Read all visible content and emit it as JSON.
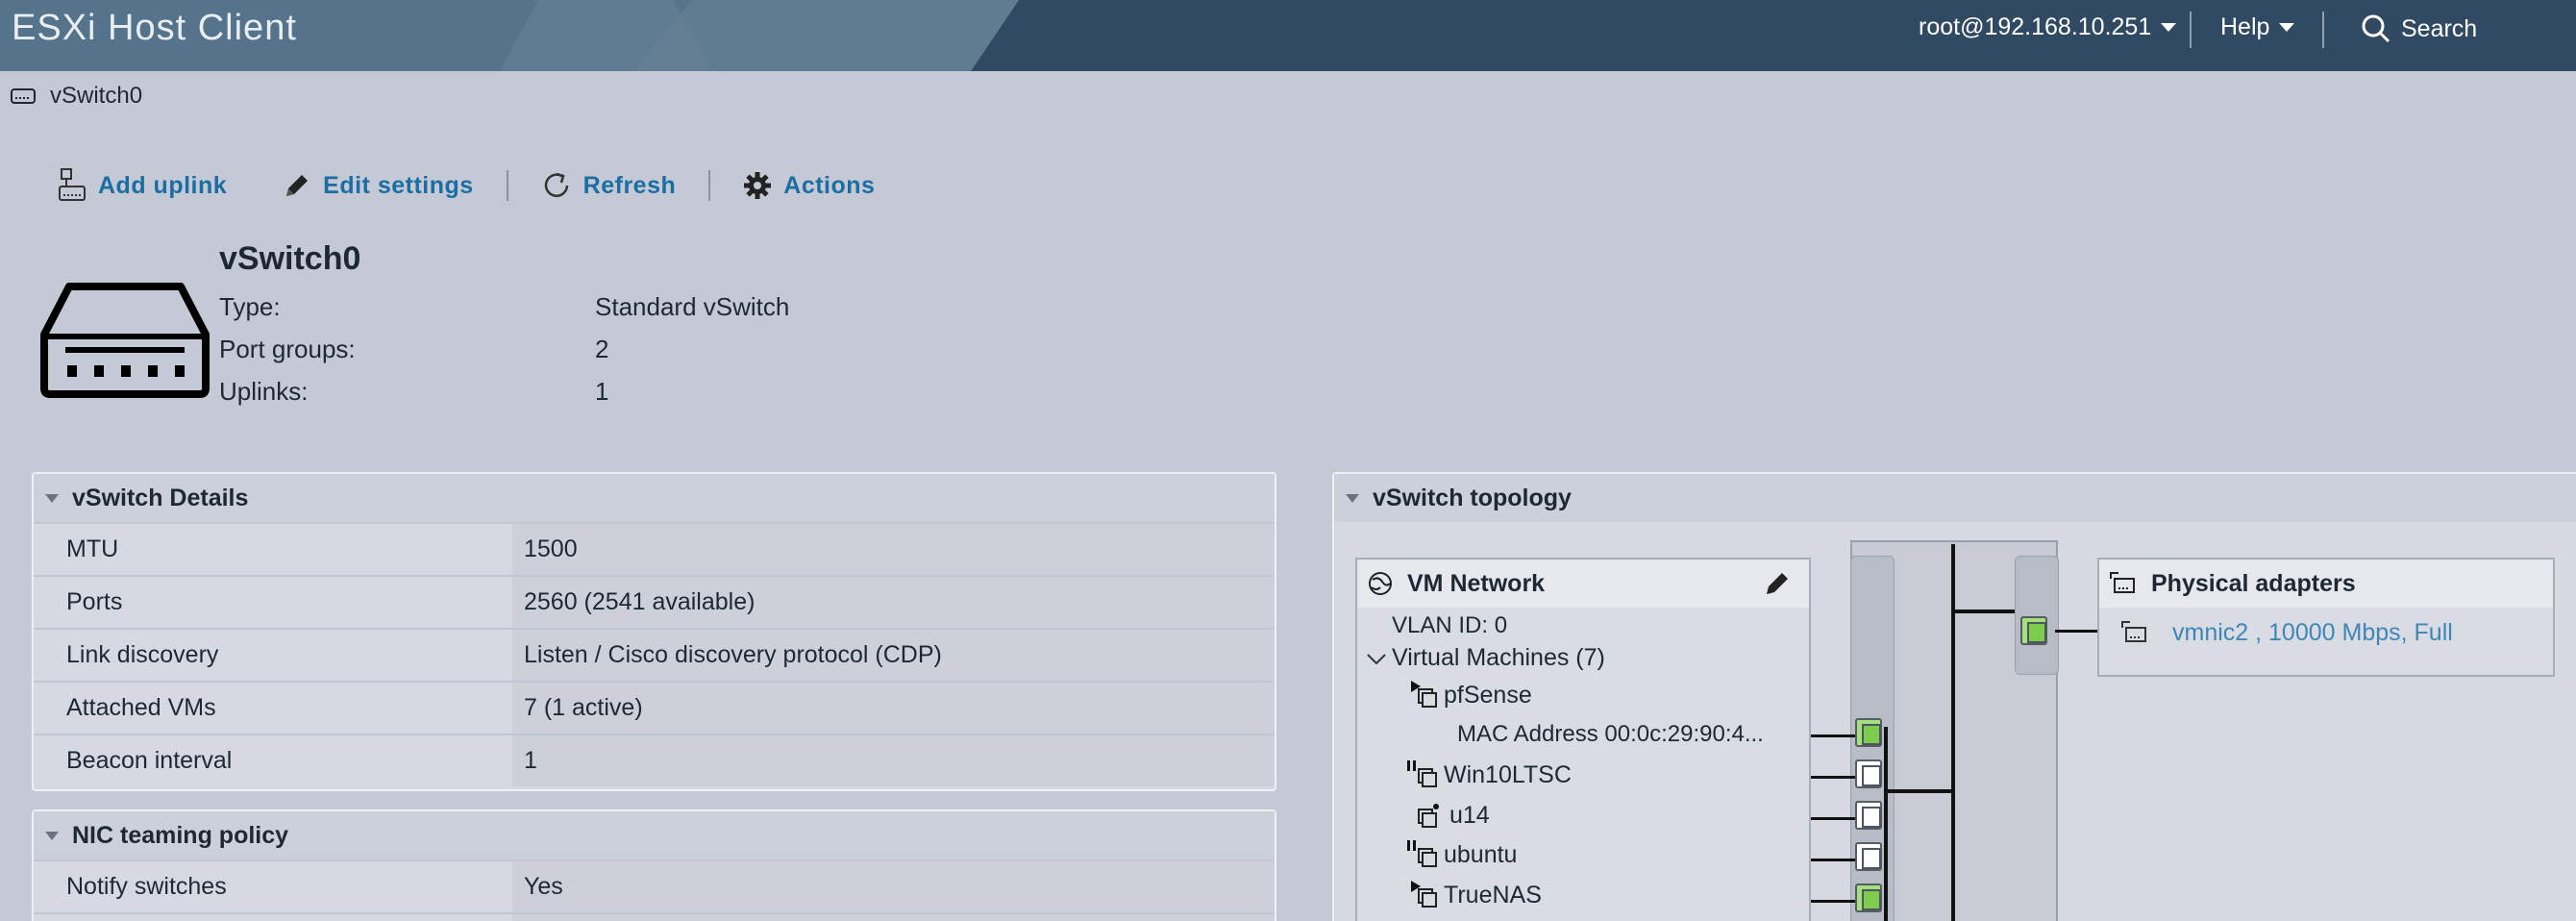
{
  "header": {
    "app_title": "ESXi Host Client",
    "user": "root@192.168.10.251",
    "help": "Help",
    "search": "Search"
  },
  "breadcrumb": {
    "label": "vSwitch0"
  },
  "toolbar": {
    "add_uplink": "Add uplink",
    "edit_settings": "Edit settings",
    "refresh": "Refresh",
    "actions": "Actions"
  },
  "summary": {
    "title": "vSwitch0",
    "rows": [
      {
        "label": "Type:",
        "value": "Standard vSwitch"
      },
      {
        "label": "Port groups:",
        "value": "2"
      },
      {
        "label": "Uplinks:",
        "value": "1"
      }
    ]
  },
  "details": {
    "title": "vSwitch Details",
    "rows": [
      {
        "label": "MTU",
        "value": "1500"
      },
      {
        "label": "Ports",
        "value": "2560 (2541 available)"
      },
      {
        "label": "Link discovery",
        "value": "Listen / Cisco discovery protocol (CDP)"
      },
      {
        "label": "Attached VMs",
        "value": "7 (1 active)"
      },
      {
        "label": "Beacon interval",
        "value": "1"
      }
    ]
  },
  "nic_teaming": {
    "title": "NIC teaming policy",
    "rows": [
      {
        "label": "Notify switches",
        "value": "Yes"
      }
    ]
  },
  "topology": {
    "title": "vSwitch topology",
    "port_group": {
      "name": "VM Network",
      "vlan": "VLAN ID: 0",
      "vms_header": "Virtual Machines (7)",
      "vms": [
        {
          "name": "pfSense",
          "state": "running",
          "port": "on"
        },
        {
          "name": "MAC Address 00:0c:29:90:4...",
          "state": "detail",
          "port": "on"
        },
        {
          "name": "Win10LTSC",
          "state": "paused",
          "port": "off"
        },
        {
          "name": "u14",
          "state": "off",
          "port": "off"
        },
        {
          "name": "ubuntu",
          "state": "paused",
          "port": "off"
        },
        {
          "name": "TrueNAS",
          "state": "running",
          "port": "on"
        }
      ]
    },
    "physical_adapters": {
      "title": "Physical adapters",
      "items": [
        "vmnic2 , 10000 Mbps, Full"
      ]
    }
  },
  "colors": {
    "header_bg": "#2f4a62",
    "link": "#1b6ea3",
    "page_bg": "#c5c9d5",
    "port_active": "#7ccd4c"
  }
}
